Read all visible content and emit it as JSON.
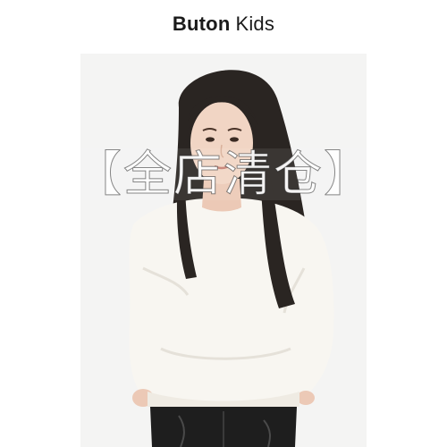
{
  "brand": {
    "name_bold": "Buton",
    "name_light": "Kids"
  },
  "banner": {
    "text": "【全店清仓】"
  },
  "photo": {
    "subject": "product-photo",
    "sweater_color": "#f8f6f1",
    "hair_color": "#2a2522",
    "skin_color": "#f1d5c4",
    "pants_color": "#1e1e1e",
    "background_color": "#f4f4f3"
  }
}
